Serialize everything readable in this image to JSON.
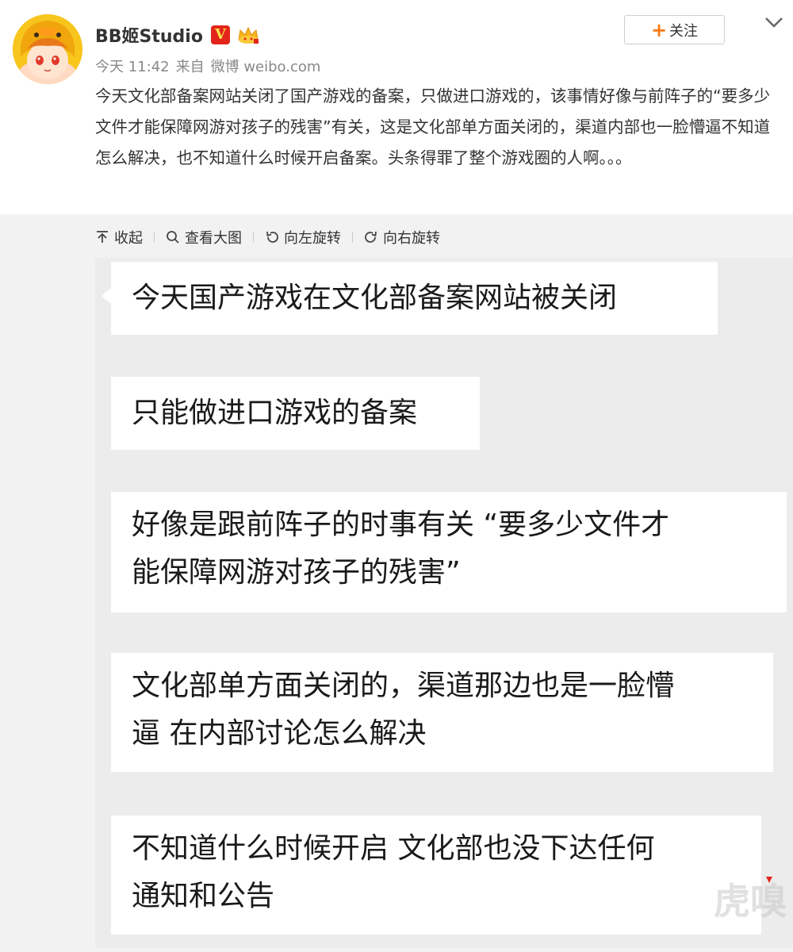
{
  "post": {
    "username": "BB姬Studio",
    "badge_label": "V",
    "time": "今天 11:42",
    "source_prefix": "来自",
    "source": "微博 weibo.com",
    "follow_label": "关注",
    "text": "今天文化部备案网站关闭了国产游戏的备案，只做进口游戏的，该事情好像与前阵子的“要多少文件才能保障网游对孩子的残害”有关，这是文化部单方面关闭的，渠道内部也一脸懵逼不知道怎么解决，也不知道什么时候开启备案。头条得罪了整个游戏圈的人啊。。。"
  },
  "toolbar": {
    "collapse": "收起",
    "view_large": "查看大图",
    "rotate_left": "向左旋转",
    "rotate_right": "向右旋转"
  },
  "image": {
    "bubbles": [
      {
        "line1": "今天国产游戏在文化部备案网站被关闭",
        "line2": ""
      },
      {
        "line1": "只能做进口游戏的备案",
        "line2": ""
      },
      {
        "line1": "好像是跟前阵子的时事有关  “要多少文件才",
        "line2": "能保障网游对孩子的残害”"
      },
      {
        "line1": "文化部单方面关闭的，渠道那边也是一脸懵",
        "line2": "逼 在内部讨论怎么解决"
      },
      {
        "line1": "不知道什么时候开启  文化部也没下达任何",
        "line2": "通知和公告"
      }
    ],
    "watermark": "虎嗅"
  },
  "colors": {
    "accent_orange": "#ff7a13",
    "verified_red": "#e2251b",
    "text": "#333333",
    "meta": "#888888"
  }
}
